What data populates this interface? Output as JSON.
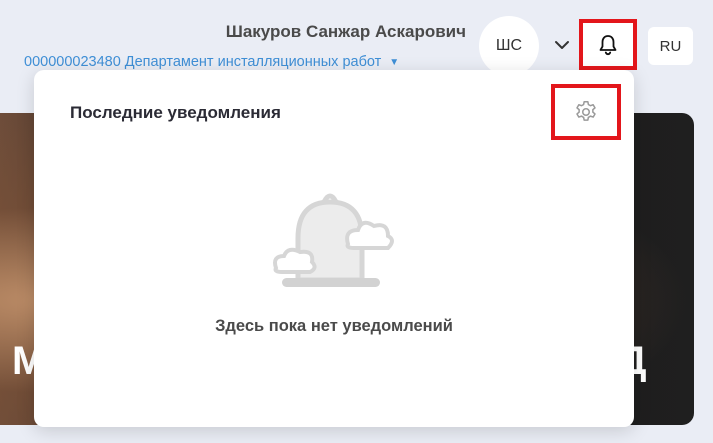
{
  "header": {
    "user_name": "Шакуров Санжар Аскарович",
    "org_label": "000000023480 Департамент инсталляционных работ",
    "org_caret": "▼",
    "avatar_initials": "ШС",
    "language": "RU",
    "bell_icon": "bell-icon",
    "chevron_icon": "chevron-down-icon"
  },
  "hero": {
    "text_left": "М",
    "text_right": "Д"
  },
  "notifications": {
    "title": "Последние уведомления",
    "settings_icon": "gear-icon",
    "empty_message": "Здесь пока нет уведомлений",
    "illustration_icon": "bell-cloud-illustration"
  },
  "colors": {
    "accent_blue": "#3f8fd6",
    "highlight_red": "#e3161b",
    "page_background": "#eaedf5",
    "panel_background": "#ffffff"
  }
}
